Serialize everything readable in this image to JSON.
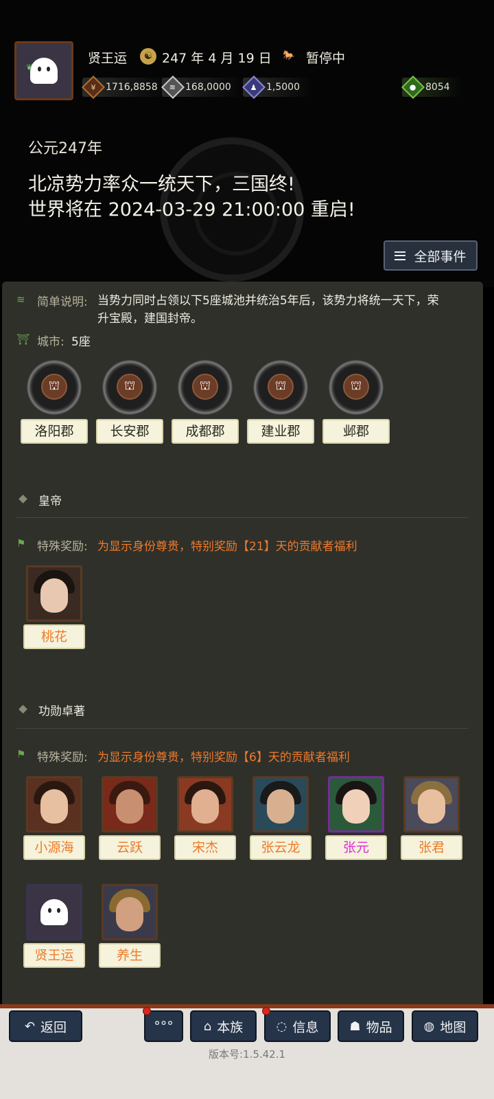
{
  "header": {
    "player_name": "贤王运",
    "date": "247 年 4 月 19 日",
    "status": "暂停中",
    "resources": [
      {
        "icon": "coin-icon",
        "value": "1716,8858"
      },
      {
        "icon": "grain-icon",
        "value": "168,0000"
      },
      {
        "icon": "soldier-icon",
        "value": "1,5000"
      },
      {
        "icon": "money-bag-icon",
        "value": "8054"
      }
    ]
  },
  "announcement": {
    "era": "公元247年",
    "line1": "北凉势力率众一统天下，三国终!",
    "line2": "世界将在 2024-03-29 21:00:00 重启!",
    "all_events_label": "全部事件"
  },
  "panel": {
    "desc_label": "简单说明:",
    "desc_text": "当势力同时占领以下5座城池并统治5年后，该势力将统一天下，荣升宝殿，建国封帝。",
    "city_label": "城市:",
    "city_count": "5座",
    "cities": [
      "洛阳郡",
      "长安郡",
      "成都郡",
      "建业郡",
      "邺郡"
    ],
    "sections": [
      {
        "title": "皇帝",
        "reward_label": "特殊奖励:",
        "reward_text": "为显示身份尊贵，特别奖励【21】天的贡献者福利",
        "heroes": [
          "桃花"
        ]
      },
      {
        "title": "功勋卓著",
        "reward_label": "特殊奖励:",
        "reward_text": "为显示身份尊贵，特别奖励【6】天的贡献者福利",
        "heroes": [
          "小源海",
          "云跃",
          "宋杰",
          "张云龙",
          "张元",
          "张君",
          "贤王运",
          "养生"
        ]
      }
    ]
  },
  "bottom_nav": {
    "back": "返回",
    "more": "°°°",
    "clan": "本族",
    "info": "信息",
    "items": "物品",
    "map": "地图",
    "version": "版本号:1.5.42.1"
  },
  "colors": {
    "reward_text": "#f07a2a",
    "special_hero_name": "#e02ad8",
    "panel_bg": "#2f302a",
    "button_bg": "#26344a"
  }
}
